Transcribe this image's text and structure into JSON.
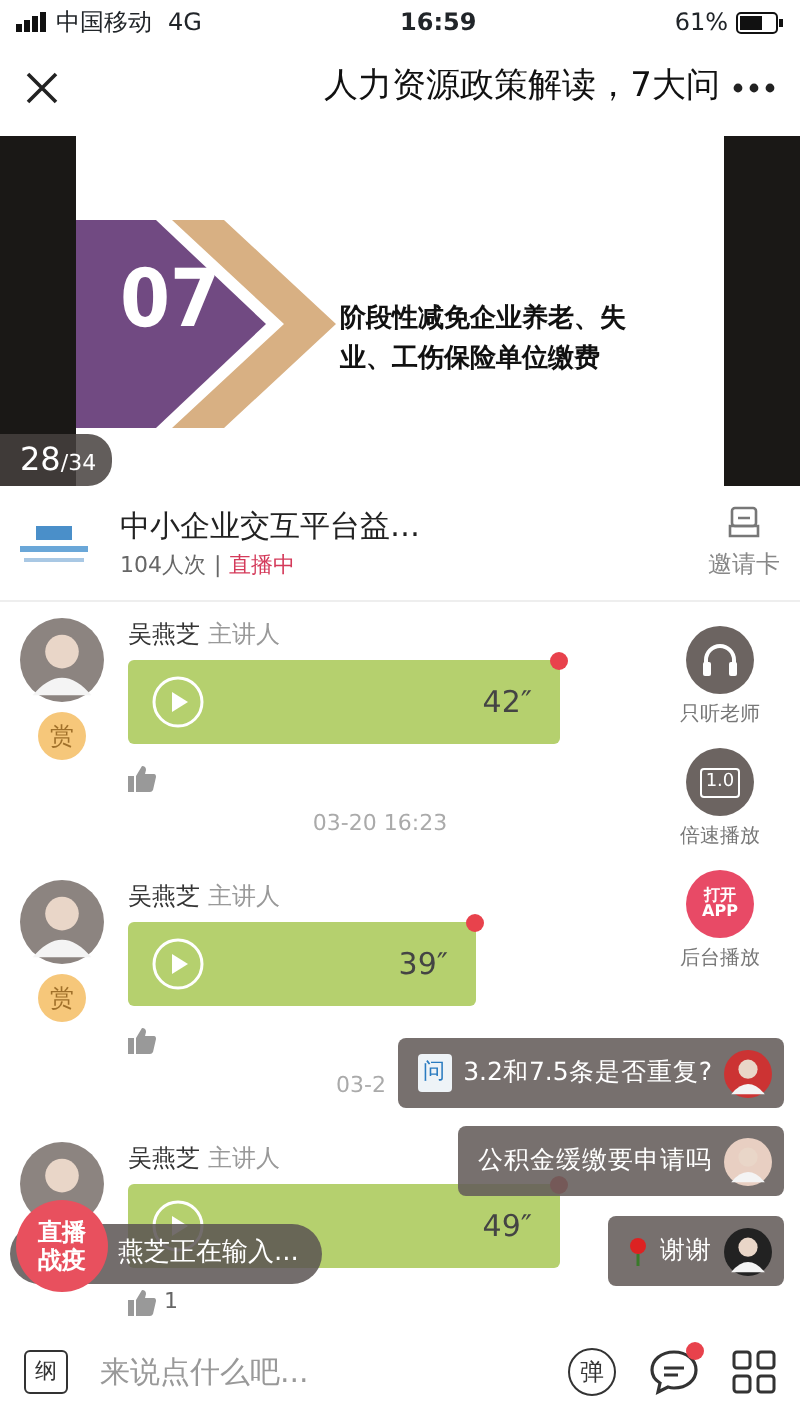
{
  "status_bar": {
    "carrier": "中国移动",
    "network": "4G",
    "time": "16:59",
    "battery": "61%"
  },
  "nav": {
    "title": "人力资源政策解读，7大问"
  },
  "slide": {
    "number": "07",
    "text": "阶段性减免企业养老、失业、工伤保险单位缴费",
    "current": "28",
    "total": "/34"
  },
  "channel": {
    "name": "中小企业交互平台益…",
    "views": "104人次",
    "separator": "|",
    "status": "直播中",
    "invite": "邀请卡"
  },
  "side_buttons": [
    {
      "kind": "headphones",
      "label": "只听老师"
    },
    {
      "kind": "speed",
      "icon_text": "1.0",
      "label": "倍速播放"
    },
    {
      "kind": "app",
      "icon_text": "打开",
      "icon_text_2": "APP",
      "label": "后台播放"
    }
  ],
  "messages": [
    {
      "kind": "audio",
      "name": "吴燕芝",
      "role": "主讲人",
      "reward": "赏",
      "duration": "42″",
      "unread": true,
      "timestamp": "03-20 16:23"
    },
    {
      "kind": "audio",
      "name": "吴燕芝",
      "role": "主讲人",
      "reward": "赏",
      "duration": "39″",
      "unread": true,
      "timestamp": "03-2"
    },
    {
      "kind": "audio",
      "name": "吴燕芝",
      "role": "主讲人",
      "duration": "49″",
      "unread": true,
      "likes": "1"
    }
  ],
  "comments": [
    {
      "kind": "question",
      "tag": "问",
      "text": "3.2和7.5条是否重复?"
    },
    {
      "kind": "plain",
      "text": "公积金缓缴要申请吗"
    },
    {
      "kind": "gift",
      "text": "谢谢"
    }
  ],
  "typing": "燕芝正在输入...",
  "live_badge": {
    "line1": "直播",
    "line2": "战疫"
  },
  "input_bar": {
    "outline_icon": "纲",
    "placeholder": "来说点什么吧...",
    "danmaku_icon": "弹",
    "chat_unread": true
  }
}
